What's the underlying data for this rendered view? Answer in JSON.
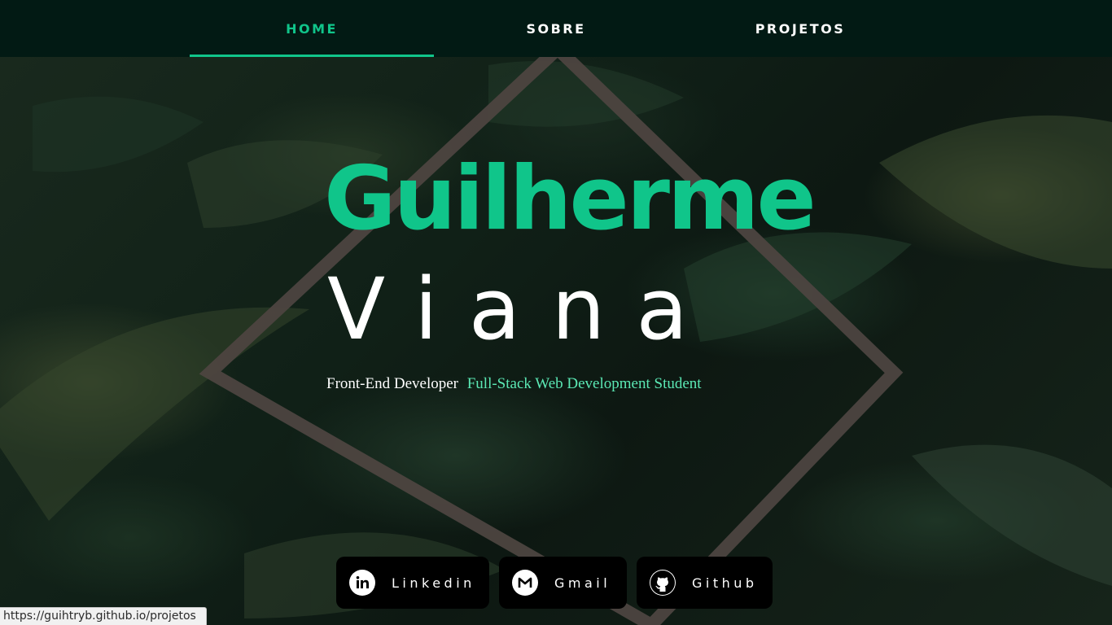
{
  "nav": {
    "items": [
      {
        "label": "HOME",
        "active": true
      },
      {
        "label": "SOBRE",
        "active": false
      },
      {
        "label": "PROJETOS",
        "active": false
      }
    ]
  },
  "hero": {
    "first_name": "Guilherme",
    "last_name": "Viana",
    "role_primary": "Front-End Developer",
    "role_secondary": "Full-Stack Web Development Student"
  },
  "social": [
    {
      "label": "Linkedin",
      "icon": "linkedin-icon"
    },
    {
      "label": "Gmail",
      "icon": "gmail-icon"
    },
    {
      "label": "Github",
      "icon": "github-icon"
    }
  ],
  "status_bar": {
    "url": "https://guihtryb.github.io/projetos"
  },
  "colors": {
    "accent": "#10c58a",
    "accent_light": "#5be8b4",
    "nav_bg": "#021a14",
    "frame": "#4d4440"
  }
}
